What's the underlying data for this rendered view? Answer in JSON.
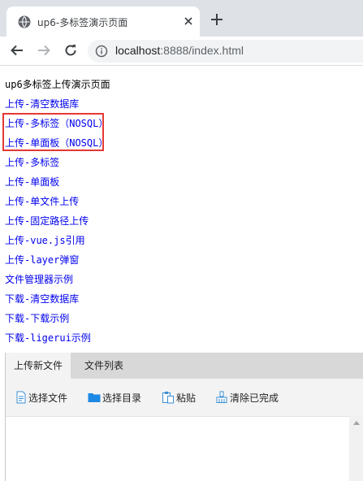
{
  "browser": {
    "tab_title": "up6-多标签演示页面",
    "url_host": "localhost",
    "url_rest": ":8888/index.html"
  },
  "page": {
    "heading": "up6多标签上传演示页面",
    "links": [
      "上传-清空数据库",
      "上传-多标签（NOSQL）",
      "上传-单面板（NOSQL）",
      "上传-多标签",
      "上传-单面板",
      "上传-单文件上传",
      "上传-固定路径上传",
      "上传-vue.js引用",
      "上传-layer弹窗",
      "文件管理器示例",
      "下载-清空数据库",
      "下载-下载示例",
      "下载-ligerui示例"
    ]
  },
  "uploader": {
    "tabs": [
      "上传新文件",
      "文件列表"
    ],
    "active_tab": "上传新文件",
    "tools": [
      {
        "label": "选择文件",
        "icon": "file-icon"
      },
      {
        "label": "选择目录",
        "icon": "folder-icon"
      },
      {
        "label": "粘贴",
        "icon": "paste-icon"
      },
      {
        "label": "清除已完成",
        "icon": "clear-icon"
      }
    ]
  },
  "colors": {
    "link": "#0000ee",
    "highlight": "#e53935",
    "tabstrip": "#dee1e6"
  }
}
